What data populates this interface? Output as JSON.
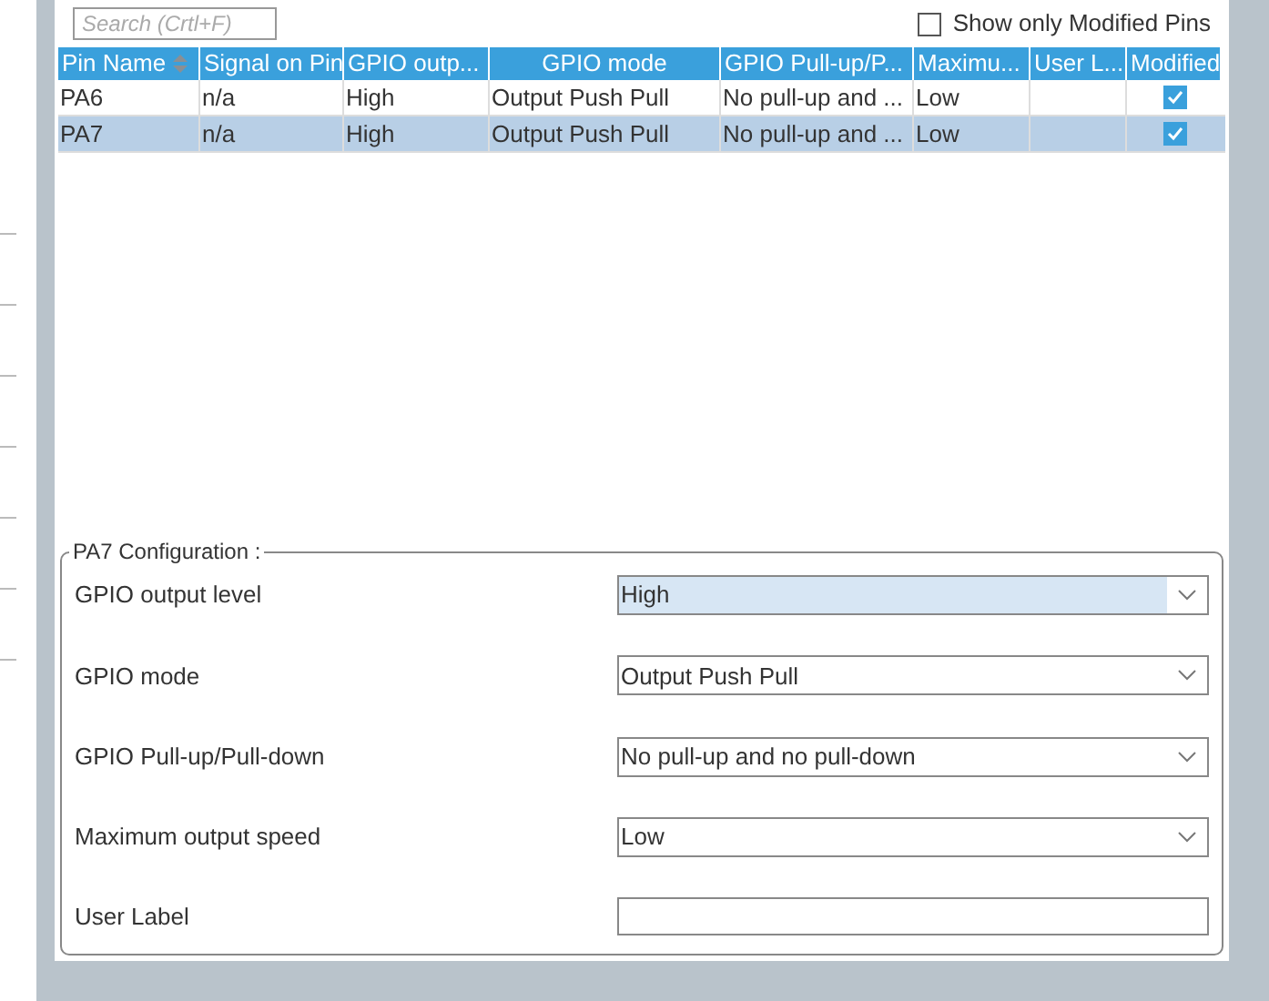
{
  "search": {
    "placeholder": "Search (Crtl+F)"
  },
  "show_only_modified": {
    "label": "Show only Modified Pins",
    "checked": false
  },
  "table": {
    "columns": [
      {
        "label": "Pin Name",
        "sorted": true
      },
      {
        "label": "Signal on Pin"
      },
      {
        "label": "GPIO outp..."
      },
      {
        "label": "GPIO mode"
      },
      {
        "label": "GPIO Pull-up/P..."
      },
      {
        "label": "Maximu..."
      },
      {
        "label": "User L..."
      },
      {
        "label": "Modified"
      }
    ],
    "rows": [
      {
        "selected": false,
        "cells": [
          "PA6",
          "n/a",
          "High",
          "Output Push Pull",
          "No pull-up and ...",
          "Low"
        ],
        "modified": true
      },
      {
        "selected": true,
        "cells": [
          "PA7",
          "n/a",
          "High",
          "Output Push Pull",
          "No pull-up and ...",
          "Low"
        ],
        "modified": true
      }
    ]
  },
  "configuration": {
    "title": "PA7 Configuration :",
    "fields": [
      {
        "kind": "select",
        "label": "GPIO output level",
        "value": "High",
        "focused": true
      },
      {
        "kind": "select",
        "label": "GPIO mode",
        "value": "Output Push Pull",
        "focused": false
      },
      {
        "kind": "select",
        "label": "GPIO Pull-up/Pull-down",
        "value": "No pull-up and no pull-down",
        "focused": false
      },
      {
        "kind": "select",
        "label": "Maximum output speed",
        "value": "Low",
        "focused": false
      },
      {
        "kind": "text",
        "label": "User Label",
        "focused": false
      }
    ]
  }
}
